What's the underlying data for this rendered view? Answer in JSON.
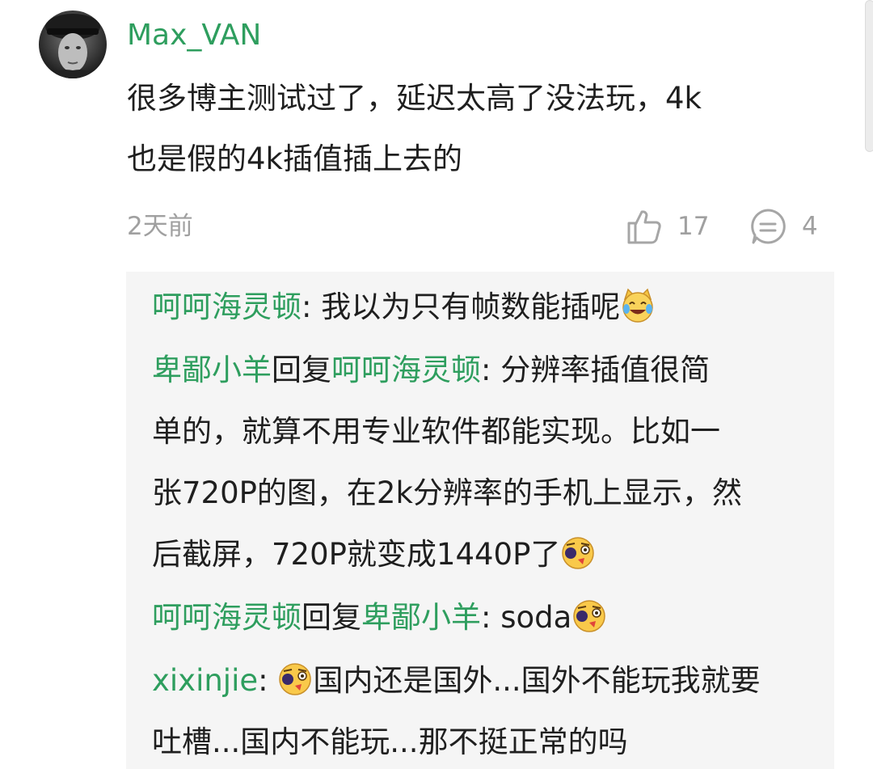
{
  "comment": {
    "username": "Max_VAN",
    "text_line1": "很多博主测试过了，延迟太高了没法玩，4k",
    "text_line2": "也是假的4k插值插上去的",
    "time": "2天前",
    "like_count": "17",
    "reply_count": "4",
    "avatar_icon": "avatar-man-photo"
  },
  "replies": [
    {
      "author": "呵呵海灵顿",
      "separator": ": ",
      "text": "我以为只有帧数能插呢",
      "emoji": "laughing-tears-cat-emoji"
    },
    {
      "author": "卑鄙小羊",
      "reply_word": "回复",
      "reply_to": "呵呵海灵顿",
      "separator": ": ",
      "line1": "分辨率插值很简",
      "line2": "单的，就算不用专业软件都能实现。比如一",
      "line3": "张720P的图，在2k分辨率的手机上显示，然",
      "line4": "后截屏，720P就变成1440P了",
      "emoji": "smirk-emoji"
    },
    {
      "author": "呵呵海灵顿",
      "reply_word": "回复",
      "reply_to": "卑鄙小羊",
      "separator": ": ",
      "text": "soda",
      "emoji": "smirk-emoji"
    },
    {
      "author": "xixinjie",
      "separator": ": ",
      "line1": "国内还是国外...国外不能玩我就要",
      "line2": "吐槽...国内不能玩...那不挺正常的吗",
      "emoji": "smirk-emoji"
    }
  ],
  "colors": {
    "username_green": "#2e9e5e",
    "text": "#1f1f1f",
    "meta_gray": "#a0a0a0",
    "reply_bg": "#f5f5f5"
  }
}
